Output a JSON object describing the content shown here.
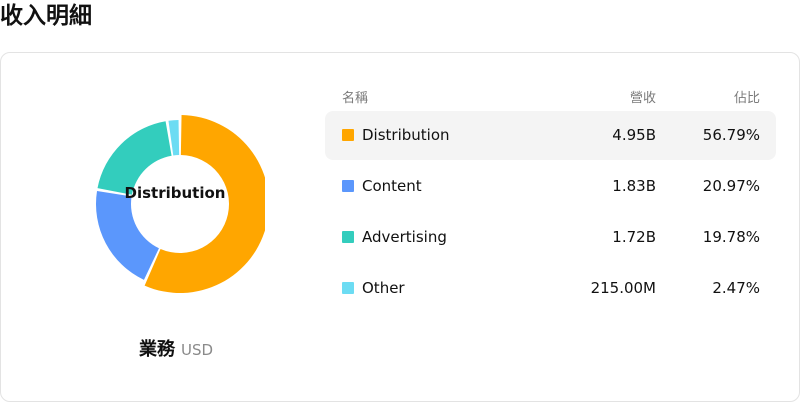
{
  "page": {
    "title": "收入明細"
  },
  "chart": {
    "center_label": "Distribution",
    "caption_title": "業務",
    "caption_unit": "USD"
  },
  "table": {
    "headers": {
      "name": "名稱",
      "revenue": "營收",
      "share": "佔比"
    },
    "active_index": 0,
    "rows": [
      {
        "name": "Distribution",
        "revenue": "4.95B",
        "share": "56.79%",
        "color": "#ffa600"
      },
      {
        "name": "Content",
        "revenue": "1.83B",
        "share": "20.97%",
        "color": "#5b97fc"
      },
      {
        "name": "Advertising",
        "revenue": "1.72B",
        "share": "19.78%",
        "color": "#33cdbd"
      },
      {
        "name": "Other",
        "revenue": "215.00M",
        "share": "2.47%",
        "color": "#6cdcf3"
      }
    ]
  },
  "chart_data": {
    "type": "pie",
    "categories": [
      "Distribution",
      "Content",
      "Advertising",
      "Other"
    ],
    "values": [
      56.79,
      20.97,
      19.78,
      2.47
    ],
    "colors": [
      "#ffa600",
      "#5b97fc",
      "#33cdbd",
      "#6cdcf3"
    ],
    "donut": true,
    "highlighted": "Distribution"
  }
}
